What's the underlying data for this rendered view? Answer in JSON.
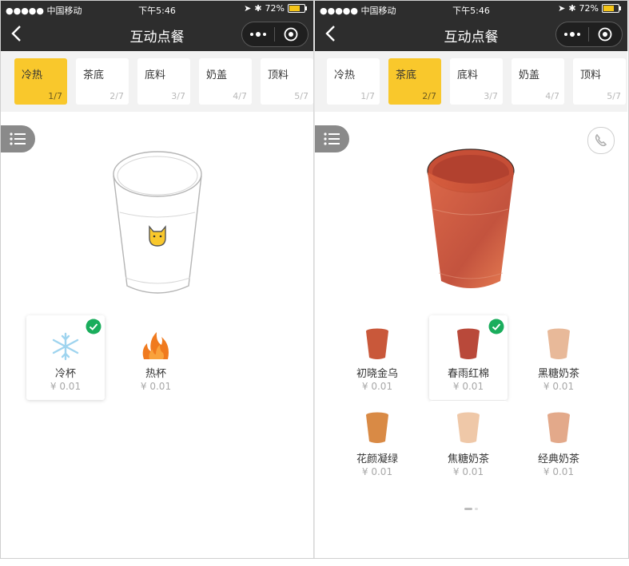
{
  "colors": {
    "accent": "#f9c82c",
    "nav_bg": "#2d2d2d",
    "check": "#1aad5c"
  },
  "status_bar": {
    "carrier": "●●●●● 中国移动",
    "time": "下午5:46",
    "battery": "72%"
  },
  "nav": {
    "title": "互动点餐",
    "back_icon": "chevron-left-icon",
    "more_icon": "more-dots-icon",
    "close_icon": "target-circle-icon"
  },
  "screens": [
    {
      "tabs": [
        {
          "label": "冷热",
          "step": "1/7",
          "active": true
        },
        {
          "label": "茶底",
          "step": "2/7"
        },
        {
          "label": "底料",
          "step": "3/7"
        },
        {
          "label": "奶盖",
          "step": "4/7"
        },
        {
          "label": "顶料",
          "step": "5/7"
        }
      ],
      "items": [
        {
          "name": "冷杯",
          "price": "¥ 0.01",
          "icon": "snowflake-icon",
          "selected": true
        },
        {
          "name": "热杯",
          "price": "¥ 0.01",
          "icon": "flame-icon"
        }
      ]
    },
    {
      "tabs": [
        {
          "label": "冷热",
          "step": "1/7"
        },
        {
          "label": "茶底",
          "step": "2/7",
          "active": true
        },
        {
          "label": "底料",
          "step": "3/7"
        },
        {
          "label": "奶盖",
          "step": "4/7"
        },
        {
          "label": "顶料",
          "step": "5/7"
        }
      ],
      "items": [
        {
          "name": "初晓金乌",
          "price": "¥ 0.01",
          "color": "#c9583a"
        },
        {
          "name": "春雨红棉",
          "price": "¥ 0.01",
          "color": "#b9493a",
          "selected": true
        },
        {
          "name": "黑糖奶茶",
          "price": "¥ 0.01",
          "color": "#e8b999"
        },
        {
          "name": "花颜凝绿",
          "price": "¥ 0.01",
          "color": "#d98a45"
        },
        {
          "name": "焦糖奶茶",
          "price": "¥ 0.01",
          "color": "#efc8a8"
        },
        {
          "name": "经典奶茶",
          "price": "¥ 0.01",
          "color": "#e3a98a"
        }
      ]
    }
  ]
}
